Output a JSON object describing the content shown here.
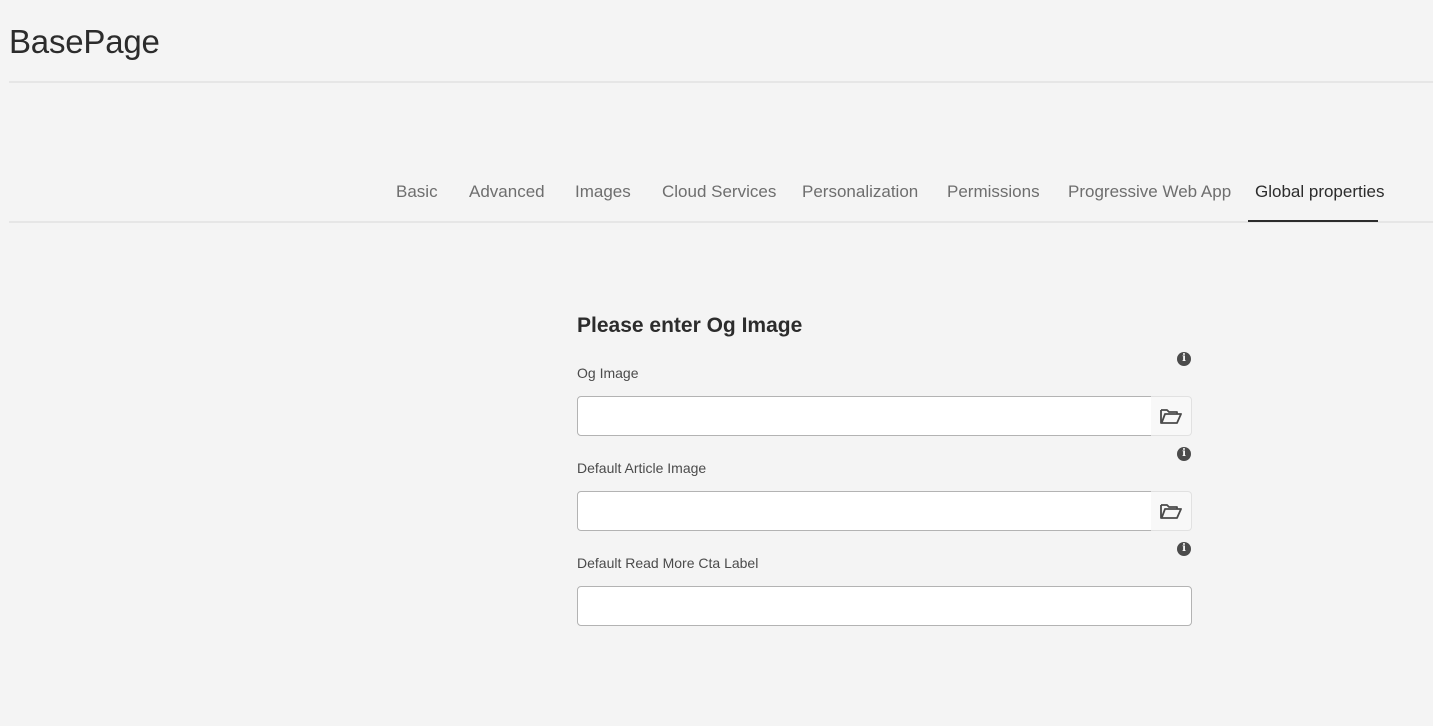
{
  "page": {
    "title": "BasePage"
  },
  "tabs": [
    {
      "label": "Basic",
      "selected": false
    },
    {
      "label": "Advanced",
      "selected": false
    },
    {
      "label": "Images",
      "selected": false
    },
    {
      "label": "Cloud Services",
      "selected": false
    },
    {
      "label": "Personalization",
      "selected": false
    },
    {
      "label": "Permissions",
      "selected": false
    },
    {
      "label": "Progressive Web App",
      "selected": false
    },
    {
      "label": "Global properties",
      "selected": true
    }
  ],
  "form": {
    "heading": "Please enter Og Image",
    "fields": [
      {
        "label": "Og Image",
        "value": "",
        "has_browse": true,
        "info_icon": "info-icon",
        "browse_icon": "folder-open-icon"
      },
      {
        "label": "Default Article Image",
        "value": "",
        "has_browse": true,
        "info_icon": "info-icon",
        "browse_icon": "folder-open-icon"
      },
      {
        "label": "Default Read More Cta Label",
        "value": "",
        "has_browse": false,
        "info_icon": "info-icon"
      }
    ]
  },
  "colors": {
    "background": "#f4f4f4",
    "text": "#2c2c2c",
    "tab_inactive": "#6e6e6e",
    "tab_active_indicator": "#2c2c2c"
  }
}
